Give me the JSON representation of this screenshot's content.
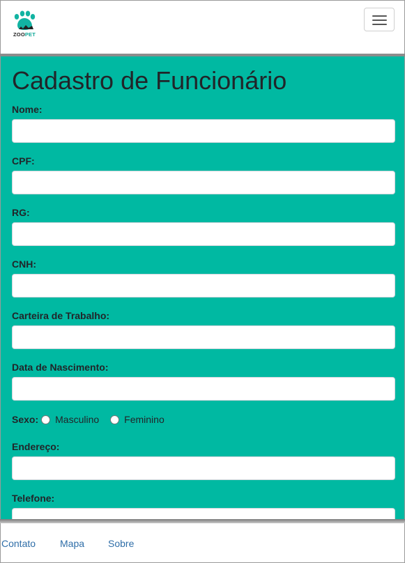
{
  "header": {
    "logo_text_zoo": "ZOO",
    "logo_text_pet": "PET",
    "menu_toggle_icon": "hamburger-icon"
  },
  "form": {
    "title": "Cadastro de Funcionário",
    "fields": [
      {
        "label": "Nome:",
        "value": ""
      },
      {
        "label": "CPF:",
        "value": ""
      },
      {
        "label": "RG:",
        "value": ""
      },
      {
        "label": "CNH:",
        "value": ""
      },
      {
        "label": "Carteira de Trabalho:",
        "value": ""
      },
      {
        "label": "Data de Nascimento:",
        "value": ""
      }
    ],
    "sexo": {
      "label": "Sexo:",
      "options": [
        "Masculino",
        "Feminino"
      ],
      "selected": null
    },
    "fields_after": [
      {
        "label": "Endereço:",
        "value": ""
      },
      {
        "label": "Telefone:",
        "value": ""
      }
    ]
  },
  "footer": {
    "links": [
      "Contato",
      "Mapa",
      "Sobre"
    ]
  },
  "colors": {
    "main_bg": "#00b9a2",
    "link": "#2f6ea8",
    "logo_teal": "#0fa898"
  }
}
